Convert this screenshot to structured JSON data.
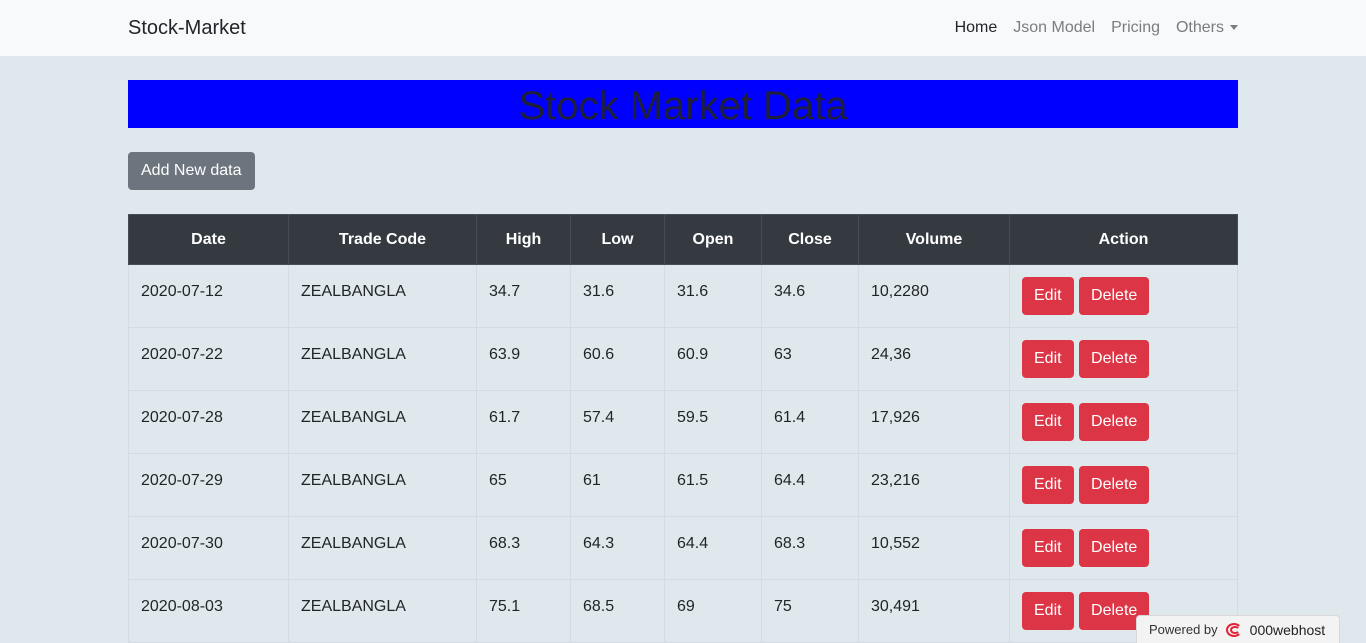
{
  "nav": {
    "brand": "Stock-Market",
    "links": [
      "Home",
      "Json Model",
      "Pricing",
      "Others"
    ]
  },
  "banner": {
    "title": "Stock Market Data"
  },
  "actions": {
    "add_label": "Add New data"
  },
  "table": {
    "headers": [
      "Date",
      "Trade Code",
      "High",
      "Low",
      "Open",
      "Close",
      "Volume",
      "Action"
    ],
    "rows": [
      [
        "2020-07-12",
        "ZEALBANGLA",
        "34.7",
        "31.6",
        "31.6",
        "34.6",
        "10,2280"
      ],
      [
        "2020-07-22",
        "ZEALBANGLA",
        "63.9",
        "60.6",
        "60.9",
        "63",
        "24,36"
      ],
      [
        "2020-07-28",
        "ZEALBANGLA",
        "61.7",
        "57.4",
        "59.5",
        "61.4",
        "17,926"
      ],
      [
        "2020-07-29",
        "ZEALBANGLA",
        "65",
        "61",
        "61.5",
        "64.4",
        "23,216"
      ],
      [
        "2020-07-30",
        "ZEALBANGLA",
        "68.3",
        "64.3",
        "64.4",
        "68.3",
        "10,552"
      ],
      [
        "2020-08-03",
        "ZEALBANGLA",
        "75.1",
        "68.5",
        "69",
        "75",
        "30,491"
      ]
    ],
    "edit_label": "Edit",
    "delete_label": "Delete"
  },
  "footer": {
    "powered_label": "Powered by",
    "host_name": "000webhost"
  },
  "colors": {
    "banner": "#0000ff",
    "danger": "#dc3545",
    "header": "#343a40",
    "secondary": "#6c757d"
  }
}
